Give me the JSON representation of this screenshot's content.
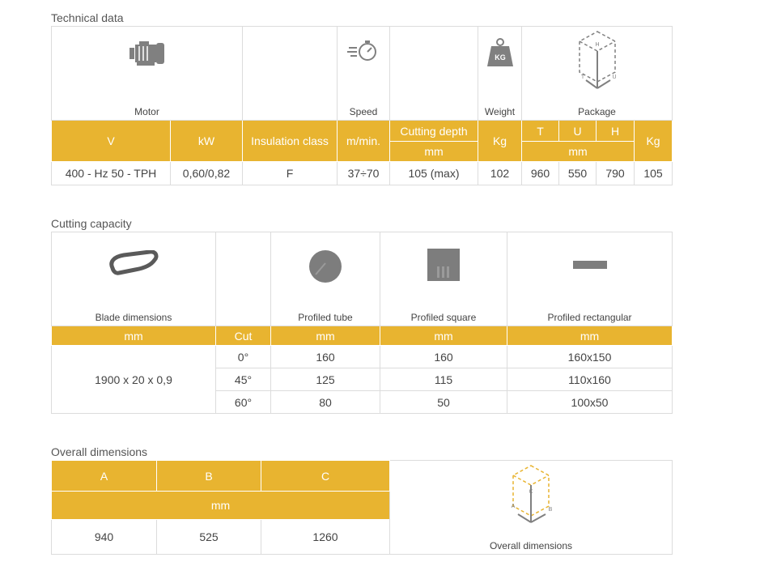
{
  "technical": {
    "title": "Technical data",
    "icons": {
      "motor": "Motor",
      "speed": "Speed",
      "weight": "Weight",
      "package": "Package",
      "weight_badge": "KG",
      "pkg_h": "H",
      "pkg_t": "T",
      "pkg_u": "U"
    },
    "headers": {
      "v": "V",
      "kw": "kW",
      "insulation": "Insulation class",
      "speed": "m/min.",
      "cutting_depth": "Cutting depth",
      "cutting_depth_unit": "mm",
      "kg": "Kg",
      "t": "T",
      "u": "U",
      "h": "H",
      "pkg_unit": "mm",
      "pkg_kg": "Kg"
    },
    "values": {
      "v": "400 - Hz 50 - TPH",
      "kw": "0,60/0,82",
      "insulation": "F",
      "speed": "37÷70",
      "cutting_depth": "105 (max)",
      "weight": "102",
      "t": "960",
      "u": "550",
      "h": "790",
      "pkg_kg": "105"
    }
  },
  "cutting": {
    "title": "Cutting capacity",
    "icons": {
      "blade": "Blade dimensions",
      "tube": "Profiled tube",
      "square": "Profiled square",
      "rect": "Profiled rectangular"
    },
    "headers": {
      "blade": "mm",
      "cut": "Cut",
      "tube": "mm",
      "square": "mm",
      "rect": "mm"
    },
    "blade_value": "1900 x 20 x 0,9",
    "rows": [
      {
        "cut": "0°",
        "tube": "160",
        "square": "160",
        "rect": "160x150"
      },
      {
        "cut": "45°",
        "tube": "125",
        "square": "115",
        "rect": "110x160"
      },
      {
        "cut": "60°",
        "tube": "80",
        "square": "50",
        "rect": "100x50"
      }
    ]
  },
  "overall": {
    "title": "Overall dimensions",
    "headers": {
      "a": "A",
      "b": "B",
      "c": "C",
      "unit": "mm"
    },
    "values": {
      "a": "940",
      "b": "525",
      "c": "1260"
    },
    "icon_label": "Overall dimensions",
    "icon_letters": {
      "a": "A",
      "b": "B",
      "c": "C"
    }
  },
  "colors": {
    "accent": "#e8b430",
    "border": "#dcdcdc",
    "icon_gray": "#808080"
  }
}
